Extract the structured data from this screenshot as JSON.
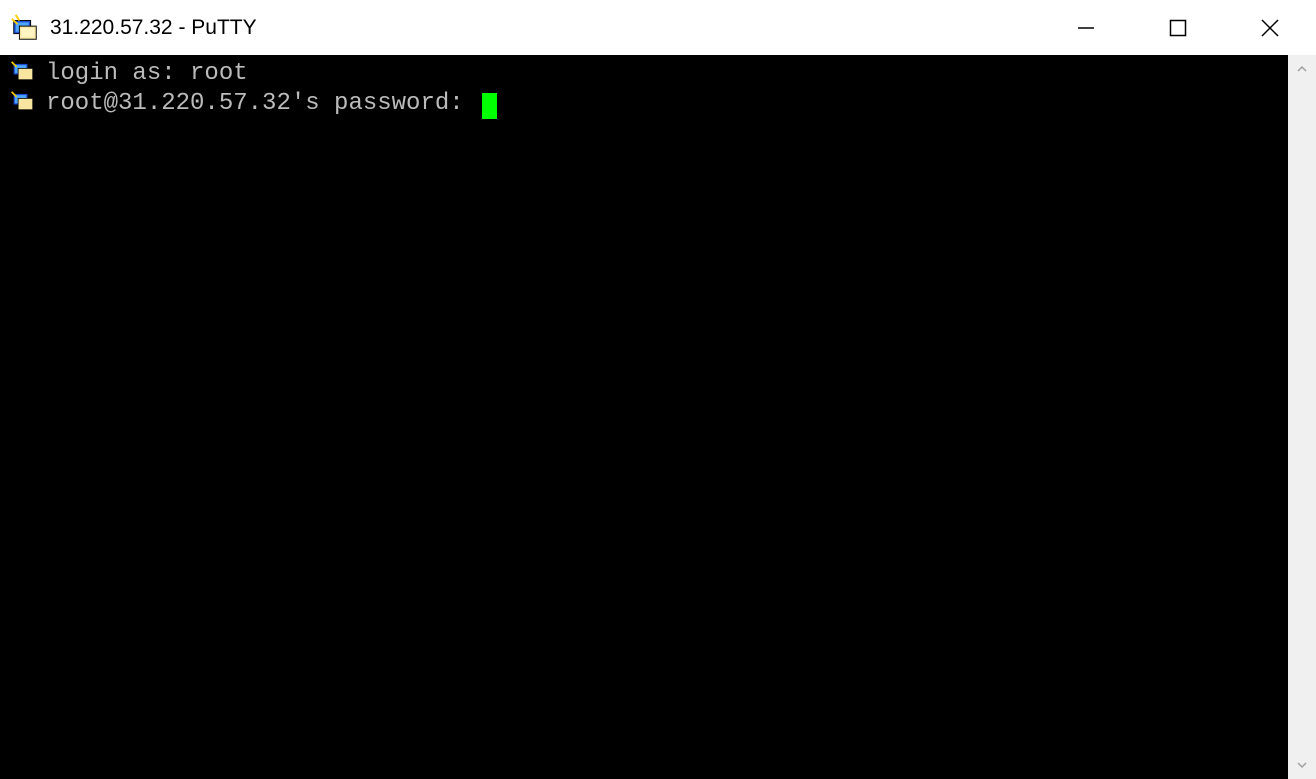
{
  "titlebar": {
    "title": "31.220.57.32 - PuTTY"
  },
  "terminal": {
    "lines": [
      "login as: root",
      "root@31.220.57.32's password: "
    ],
    "cursor_color": "#00ff00"
  }
}
